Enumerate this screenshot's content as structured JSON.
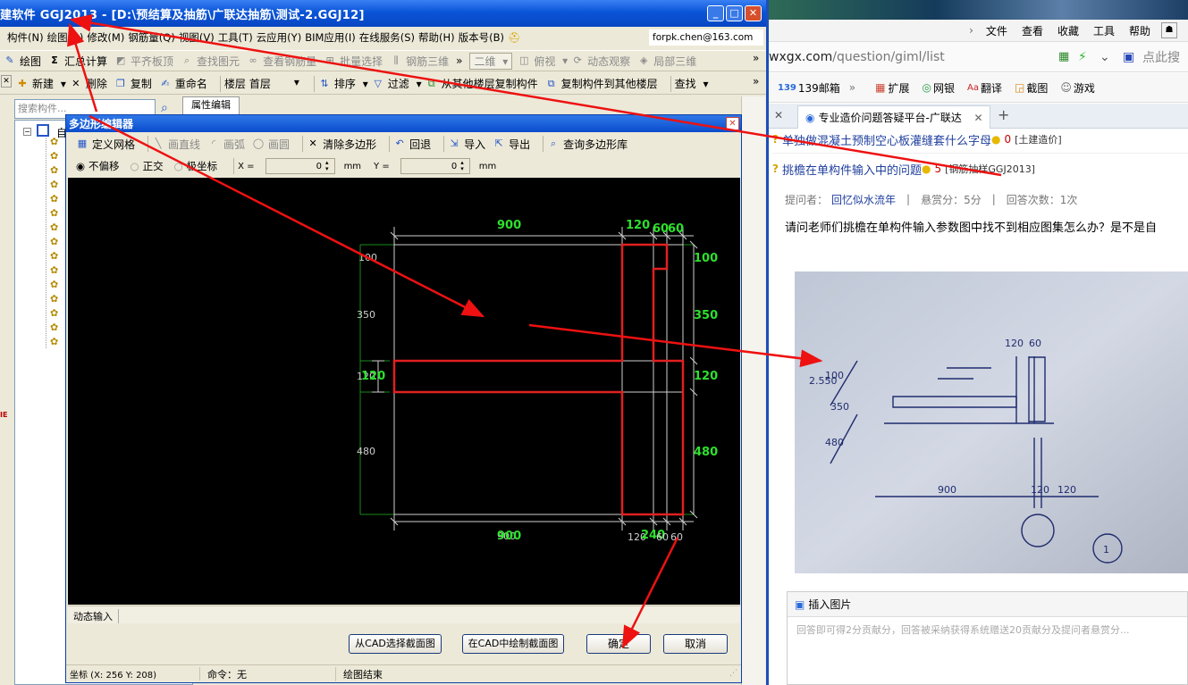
{
  "desktop": {
    "bg": "#2c5f88"
  },
  "main_window": {
    "title": "建软件 GGJ2013 - [D:\\预结算及抽筋\\广联达抽筋\\测试-2.GGJ12]",
    "menu": [
      "构件(N)",
      "绘图(D)",
      "修改(M)",
      "钢筋量(Q)",
      "视图(V)",
      "工具(T)",
      "云应用(Y)",
      "BIM应用(I)",
      "在线服务(S)",
      "帮助(H)",
      "版本号(B)"
    ],
    "account": "forpk.chen@163.com",
    "toolbar1": {
      "items": [
        "绘图",
        "汇总计算",
        "平齐板顶",
        "查找图元",
        "查看钢筋量",
        "批量选择",
        "钢筋三维"
      ],
      "view_select": "二维",
      "more": [
        "俯视",
        "动态观察",
        "局部三维"
      ]
    },
    "toolbar2": {
      "items": [
        "新建",
        "删除",
        "复制",
        "重命名"
      ],
      "floor_label": "楼层",
      "floor_value": "首层",
      "items2": [
        "排序",
        "过滤",
        "从其他楼层复制构件",
        "复制构件到其他楼层",
        "查找"
      ]
    },
    "search_placeholder": "搜索构件...",
    "tab_properties": "属性编辑",
    "tree_root": "自",
    "side_mark": "IE"
  },
  "dialog": {
    "title": "多边形编辑器",
    "toolbar": [
      "定义网格",
      "画直线",
      "画弧",
      "画圆",
      "清除多边形",
      "回退",
      "导入",
      "导出",
      "查询多边形库"
    ],
    "options": {
      "no_offset": "不偏移",
      "ortho": "正交",
      "polar": "极坐标",
      "x_label": "X =",
      "x_value": "0",
      "y_label": "Y =",
      "y_value": "0",
      "unit": "mm"
    },
    "cad": {
      "top_dims": [
        "900",
        "120",
        "60",
        "60"
      ],
      "bottom_dims": [
        "900",
        "120",
        "60",
        "60"
      ],
      "bottom_overlay": [
        "900",
        "240"
      ],
      "left_dims": [
        "100",
        "350",
        "120",
        "480"
      ],
      "left_overlay": "120",
      "right_dims": [
        "100",
        "350",
        "120",
        "480"
      ]
    },
    "dynamic_input": "动态输入",
    "buttons": {
      "cad_select": "从CAD选择截面图",
      "cad_draw": "在CAD中绘制截面图",
      "ok": "确定",
      "cancel": "取消"
    },
    "status": {
      "coord": "坐标 (X: 256 Y: 208)",
      "command": "命令：无",
      "state": "绘图结束"
    }
  },
  "browser": {
    "menu": [
      "文件",
      "查看",
      "收藏",
      "工具",
      "帮助"
    ],
    "url_domain": "wxgx.com",
    "url_path": "/question/giml/list",
    "url_hint": "点此搜",
    "favorites": [
      "139邮箱",
      "扩展",
      "网银",
      "翻译",
      "截图",
      "游戏"
    ],
    "tab_title": "专业造价问题答疑平台-广联达",
    "list": [
      {
        "title": "单独做混凝土预制空心板灌缝套什么字母",
        "score": "0",
        "tag": "[土建造价]"
      },
      {
        "title": "挑檐在单构件输入中的问题",
        "score": "5",
        "tag": "[钢筋抽样GGJ2013]"
      }
    ],
    "meta": {
      "asker_label": "提问者：",
      "asker": "回忆似水流年",
      "reward": "悬赏分：5分",
      "answers": "回答次数：1次"
    },
    "question": "请问老师们挑檐在单构件输入参数图中找不到相应图集怎么办？是不是自",
    "insert_image": "插入图片",
    "answer_placeholder": "回答即可得2分贡献分，回答被采纳获得系统赠送20贡献分及提问者悬赏分..."
  }
}
